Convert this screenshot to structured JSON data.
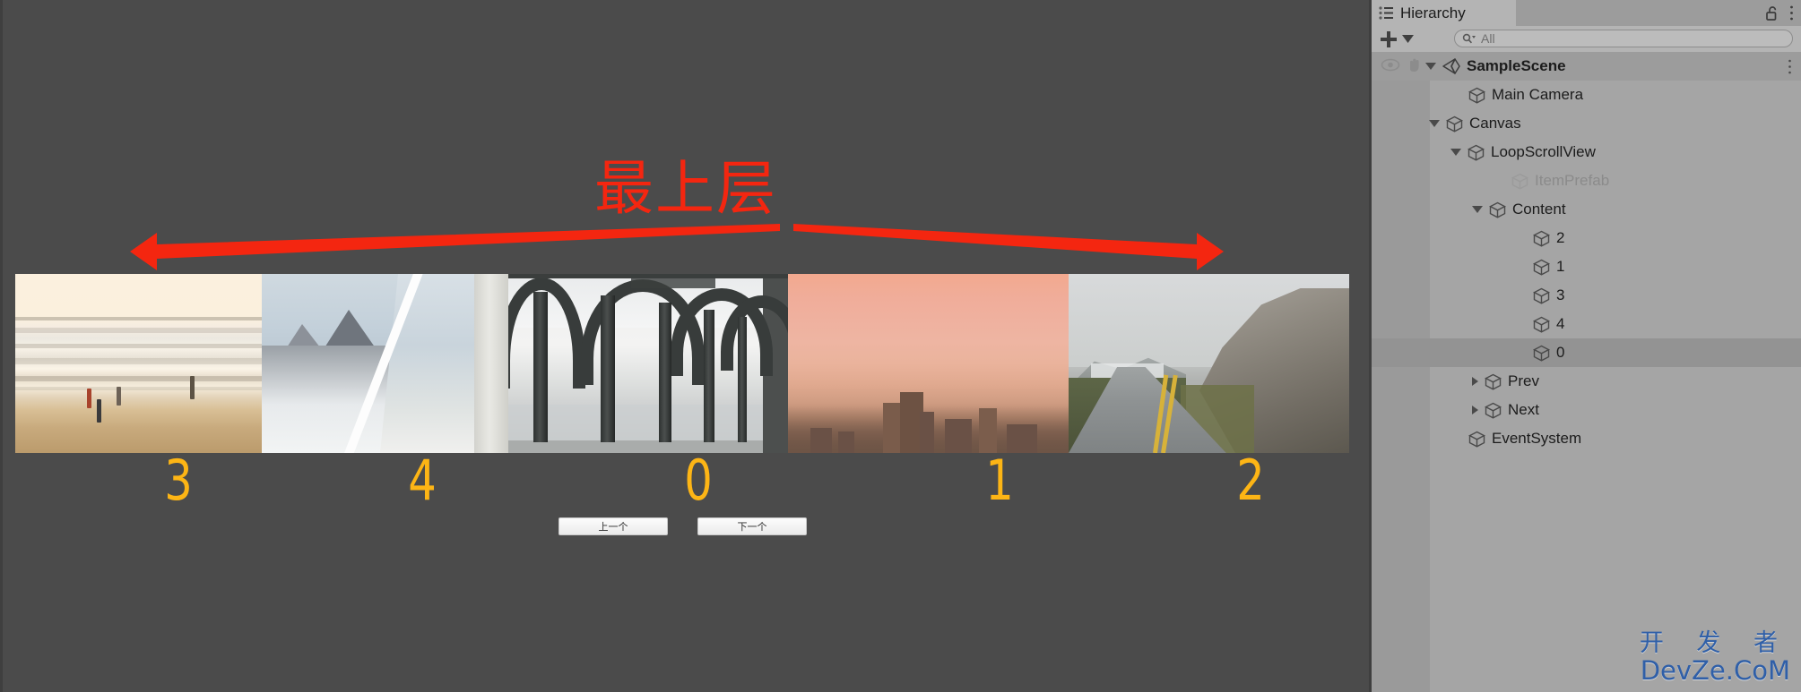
{
  "window": {
    "game_view": {
      "annotation_text": "最上层",
      "annotation_color": "#f42610",
      "left_arrow_name": "left-arrow",
      "right_arrow_name": "right-arrow",
      "items": [
        {
          "index": "3",
          "art": "beach-with-people"
        },
        {
          "index": "4",
          "art": "snowy-mountains"
        },
        {
          "index": "0",
          "art": "industrial-hall-arches"
        },
        {
          "index": "1",
          "art": "city-skyline-sunset"
        },
        {
          "index": "2",
          "art": "mountain-road"
        }
      ],
      "number_color": "#fdb515",
      "buttons": [
        {
          "label": "上一个",
          "name": "prev-button"
        },
        {
          "label": "下一个",
          "name": "next-button"
        }
      ]
    },
    "hierarchy": {
      "tab_label": "Hierarchy",
      "lock_icon": "lock-open-icon",
      "menu_icon": "kebab-menu-icon",
      "add_label": "+",
      "search": {
        "placeholder": "All",
        "value": "",
        "icon": "search-icon"
      },
      "tree": [
        {
          "label": "SampleScene",
          "depth": 0,
          "toggle": "open",
          "icon": "unity-scene-icon",
          "state": "scene",
          "has_menu": true
        },
        {
          "label": "Main Camera",
          "depth": 2,
          "toggle": "none",
          "icon": "gameobject-icon",
          "state": "normal",
          "has_menu": false
        },
        {
          "label": "Canvas",
          "depth": 1,
          "toggle": "open",
          "icon": "gameobject-icon",
          "state": "normal",
          "has_menu": false
        },
        {
          "label": "LoopScrollView",
          "depth": 2,
          "toggle": "open",
          "icon": "gameobject-icon",
          "state": "normal",
          "has_menu": false
        },
        {
          "label": "ItemPrefab",
          "depth": 4,
          "toggle": "none",
          "icon": "gameobject-icon",
          "state": "disabled",
          "has_menu": false
        },
        {
          "label": "Content",
          "depth": 3,
          "toggle": "open",
          "icon": "gameobject-icon",
          "state": "normal",
          "has_menu": false
        },
        {
          "label": "2",
          "depth": 5,
          "toggle": "none",
          "icon": "gameobject-icon",
          "state": "normal",
          "has_menu": false
        },
        {
          "label": "1",
          "depth": 5,
          "toggle": "none",
          "icon": "gameobject-icon",
          "state": "normal",
          "has_menu": false
        },
        {
          "label": "3",
          "depth": 5,
          "toggle": "none",
          "icon": "gameobject-icon",
          "state": "normal",
          "has_menu": false
        },
        {
          "label": "4",
          "depth": 5,
          "toggle": "none",
          "icon": "gameobject-icon",
          "state": "normal",
          "has_menu": false
        },
        {
          "label": "0",
          "depth": 5,
          "toggle": "none",
          "icon": "gameobject-icon",
          "state": "selected",
          "has_menu": false
        },
        {
          "label": "Prev",
          "depth": 3,
          "toggle": "closed",
          "icon": "gameobject-icon",
          "state": "normal",
          "has_menu": false
        },
        {
          "label": "Next",
          "depth": 3,
          "toggle": "closed",
          "icon": "gameobject-icon",
          "state": "normal",
          "has_menu": false
        },
        {
          "label": "EventSystem",
          "depth": 2,
          "toggle": "none",
          "icon": "gameobject-icon",
          "state": "normal",
          "has_menu": false
        }
      ]
    },
    "watermark": {
      "line1": "开 发 者",
      "line2": "DevZe.CoM",
      "color": "#2f5fa8"
    }
  }
}
